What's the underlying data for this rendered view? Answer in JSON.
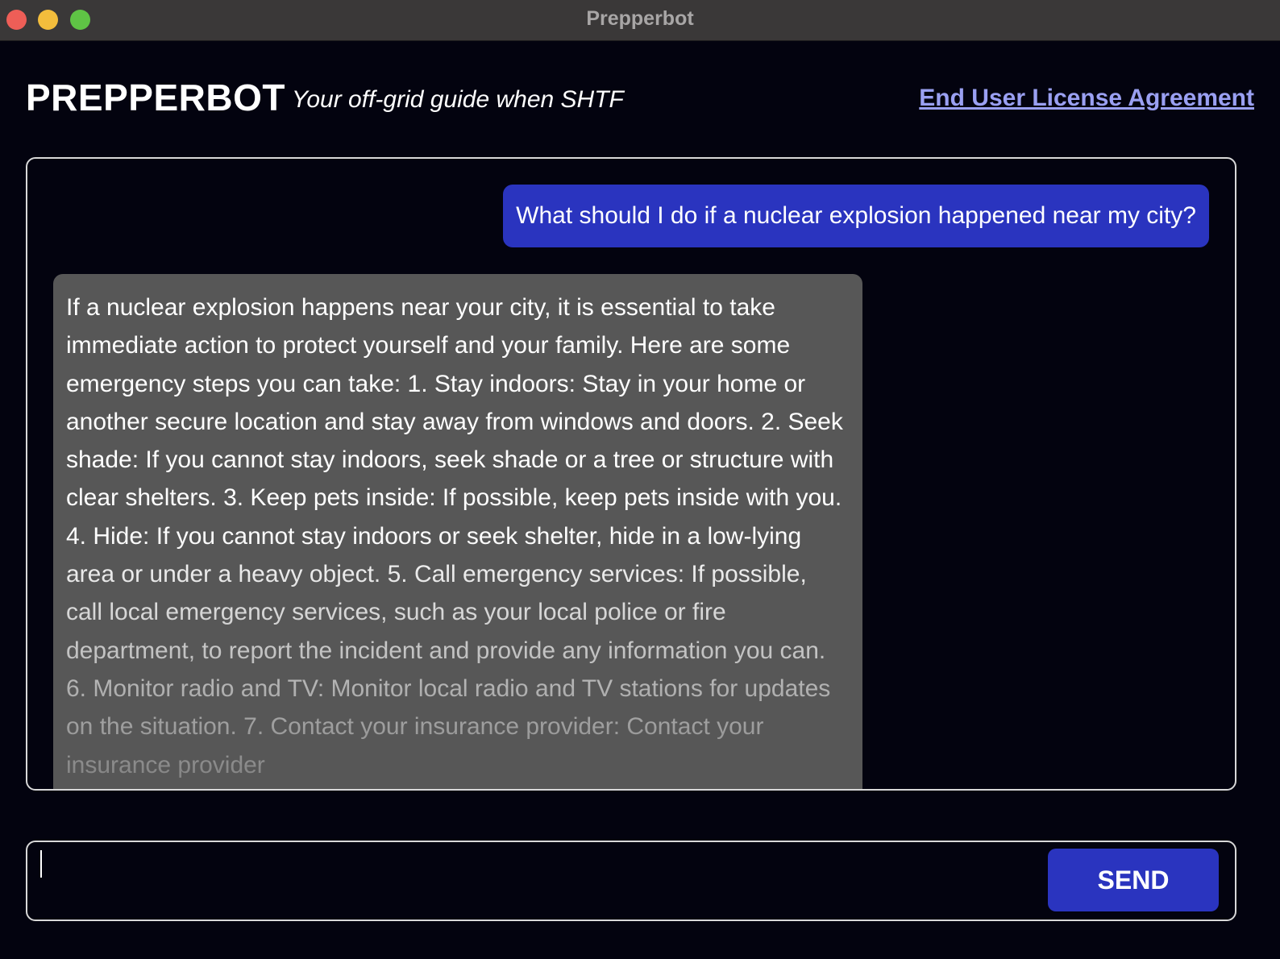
{
  "window": {
    "title": "Prepperbot"
  },
  "header": {
    "brand": "PREPPERBOT",
    "tagline": "Your off-grid guide when SHTF",
    "eula_link": "End User License Agreement"
  },
  "chat": {
    "messages": [
      {
        "role": "user",
        "text": "What should I do if a nuclear explosion happened near my city?"
      },
      {
        "role": "bot",
        "text": "If a nuclear explosion happens near your city, it is essential to take immediate action to protect yourself and your family. Here are some emergency steps you can take: 1. Stay indoors: Stay in your home or another secure location and stay away from windows and doors. 2. Seek shade: If you cannot stay indoors, seek shade or a tree or structure with clear shelters. 3. Keep pets inside: If possible, keep pets inside with you. 4. Hide: If you cannot stay indoors or seek shelter, hide in a low-lying area or under a heavy object. 5. Call emergency services: If possible, call local emergency services, such as your local police or fire department, to report the incident and provide any information you can. 6. Monitor radio and TV: Monitor local radio and TV stations for updates on the situation. 7. Contact your insurance provider: Contact your insurance provider"
      }
    ]
  },
  "composer": {
    "input_value": "",
    "send_label": "SEND"
  },
  "colors": {
    "background": "#03030f",
    "accent": "#2a34bf",
    "bot_bubble": "#575757",
    "link": "#9aa0f2"
  }
}
